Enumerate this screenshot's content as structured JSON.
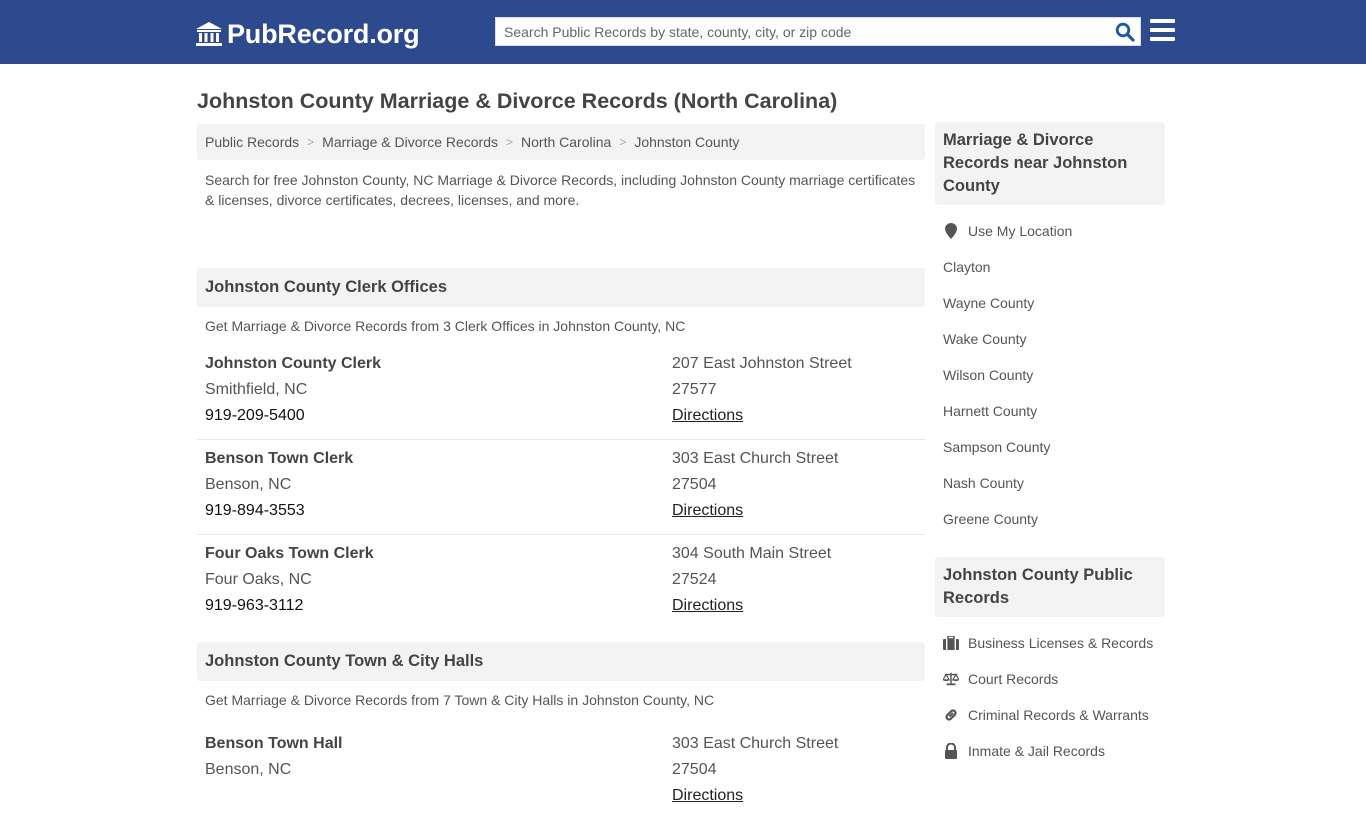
{
  "header": {
    "logo_text": "PubRecord.org",
    "search_placeholder": "Search Public Records by state, county, city, or zip code",
    "search_value": "",
    "colors": {
      "header_bg": "#2e4a8e",
      "search_icon": "#1e5aa0"
    }
  },
  "page": {
    "title": "Johnston County Marriage & Divorce Records (North Carolina)",
    "breadcrumb": [
      "Public Records",
      "Marriage & Divorce Records",
      "North Carolina",
      "Johnston County"
    ],
    "intro": "Search for free Johnston County, NC Marriage & Divorce Records, including Johnston County marriage certificates & licenses, divorce certificates, decrees, licenses, and more."
  },
  "sections": [
    {
      "heading": "Johnston County Clerk Offices",
      "subheading": "Get Marriage & Divorce Records from 3 Clerk Offices in Johnston County, NC",
      "listings": [
        {
          "name": "Johnston County Clerk",
          "city": "Smithfield, NC",
          "phone": "919-209-5400",
          "street": "207 East Johnston Street",
          "zip": "27577",
          "link": "Directions"
        },
        {
          "name": "Benson Town Clerk",
          "city": "Benson, NC",
          "phone": "919-894-3553",
          "street": "303 East Church Street",
          "zip": "27504",
          "link": "Directions"
        },
        {
          "name": "Four Oaks Town Clerk",
          "city": "Four Oaks, NC",
          "phone": "919-963-3112",
          "street": "304 South Main Street",
          "zip": "27524",
          "link": "Directions"
        }
      ]
    },
    {
      "heading": "Johnston County Town & City Halls",
      "subheading": "Get Marriage & Divorce Records from 7 Town & City Halls in Johnston County, NC",
      "listings": [
        {
          "name": "Benson Town Hall",
          "city": "Benson, NC",
          "phone": "",
          "street": "303 East Church Street",
          "zip": "27504",
          "link": "Directions"
        }
      ]
    }
  ],
  "sidebar": {
    "nearby": {
      "heading": "Marriage & Divorce Records near Johnston County",
      "location_label": "Use My Location",
      "location_icon": "map-marker-icon",
      "items": [
        "Clayton",
        "Wayne County",
        "Wake County",
        "Wilson County",
        "Harnett County",
        "Sampson County",
        "Nash County",
        "Greene County"
      ]
    },
    "public_records": {
      "heading": "Johnston County Public Records",
      "items": [
        {
          "label": "Business Licenses & Records",
          "icon": "briefcase-icon"
        },
        {
          "label": "Court Records",
          "icon": "scale-icon"
        },
        {
          "label": "Criminal Records & Warrants",
          "icon": "link-icon"
        },
        {
          "label": "Inmate & Jail Records",
          "icon": "lock-icon"
        }
      ]
    }
  }
}
